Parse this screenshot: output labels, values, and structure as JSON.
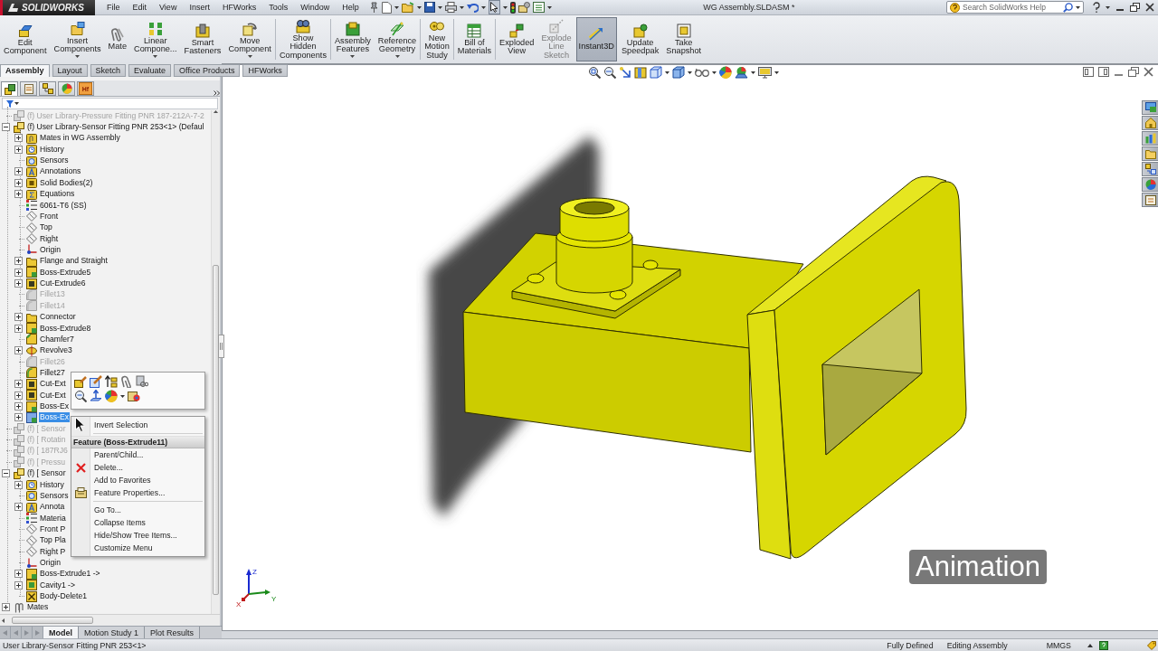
{
  "app": {
    "logo_text": "SOLIDWORKS",
    "menu": [
      "File",
      "Edit",
      "View",
      "Insert",
      "HFWorks",
      "Tools",
      "Window",
      "Help"
    ],
    "document_title": "WG Assembly.SLDASM *",
    "search": {
      "placeholder": "Search SolidWorks Help"
    }
  },
  "ribbon_groups": [
    {
      "buttons": [
        {
          "lines": [
            "Edit",
            "Component"
          ],
          "has_menu": false,
          "disabled": false,
          "selected": false
        },
        {
          "lines": [
            "Insert",
            "Components"
          ],
          "has_menu": true,
          "disabled": false,
          "selected": false
        },
        {
          "lines": [
            "Mate"
          ],
          "has_menu": false,
          "disabled": false,
          "selected": false
        },
        {
          "lines": [
            "Linear",
            "Compone..."
          ],
          "has_menu": true,
          "disabled": false,
          "selected": false
        },
        {
          "lines": [
            "Smart",
            "Fasteners"
          ],
          "has_menu": false,
          "disabled": false,
          "selected": false
        },
        {
          "lines": [
            "Move",
            "Component"
          ],
          "has_menu": true,
          "disabled": false,
          "selected": false
        }
      ]
    },
    {
      "buttons": [
        {
          "lines": [
            "Show",
            "Hidden",
            "Components"
          ],
          "has_menu": false,
          "disabled": false,
          "selected": false
        }
      ]
    },
    {
      "buttons": [
        {
          "lines": [
            "Assembly",
            "Features"
          ],
          "has_menu": true,
          "disabled": false,
          "selected": false
        },
        {
          "lines": [
            "Reference",
            "Geometry"
          ],
          "has_menu": true,
          "disabled": false,
          "selected": false
        }
      ]
    },
    {
      "buttons": [
        {
          "lines": [
            "New",
            "Motion",
            "Study"
          ],
          "has_menu": false,
          "disabled": false,
          "selected": false
        }
      ]
    },
    {
      "buttons": [
        {
          "lines": [
            "Bill of",
            "Materials"
          ],
          "has_menu": false,
          "disabled": false,
          "selected": false
        }
      ]
    },
    {
      "buttons": [
        {
          "lines": [
            "Exploded",
            "View"
          ],
          "has_menu": false,
          "disabled": false,
          "selected": false
        },
        {
          "lines": [
            "Explode",
            "Line",
            "Sketch"
          ],
          "has_menu": false,
          "disabled": true,
          "selected": false
        },
        {
          "lines": [
            "Instant3D"
          ],
          "has_menu": false,
          "disabled": false,
          "selected": true
        },
        {
          "lines": [
            "Update",
            "Speedpak"
          ],
          "has_menu": false,
          "disabled": false,
          "selected": false
        },
        {
          "lines": [
            "Take",
            "Snapshot"
          ],
          "has_menu": false,
          "disabled": false,
          "selected": false
        }
      ]
    }
  ],
  "command_tabs": [
    {
      "label": "Assembly",
      "selected": true
    },
    {
      "label": "Layout",
      "selected": false
    },
    {
      "label": "Sketch",
      "selected": false
    },
    {
      "label": "Evaluate",
      "selected": false
    },
    {
      "label": "Office Products",
      "selected": false
    },
    {
      "label": "HFWorks",
      "selected": false
    }
  ],
  "panel_tabs": [
    {
      "selected": true
    },
    {
      "selected": false
    },
    {
      "selected": false
    },
    {
      "selected": false
    },
    {
      "selected": false,
      "text": "Hf"
    }
  ],
  "feature_tree": {
    "items": [
      {
        "label": "(f) User Library-Pressure Fitting PNR 187-212A-7-2",
        "kind": "component",
        "expandable": false,
        "suppressed": true,
        "selected": false
      },
      {
        "label": "(f) User Library-Sensor Fitting PNR 253<1> (Defaul",
        "kind": "component",
        "expandable": true,
        "expanded": true,
        "suppressed": false,
        "selected": false,
        "children": [
          {
            "label": "Mates in WG Assembly",
            "kind": "mates_folder",
            "expandable": true,
            "expanded": false,
            "suppressed": false,
            "selected": false
          },
          {
            "label": "History",
            "kind": "history",
            "expandable": true,
            "expanded": false,
            "suppressed": false,
            "selected": false
          },
          {
            "label": "Sensors",
            "kind": "sensors",
            "expandable": false,
            "suppressed": false,
            "selected": false
          },
          {
            "label": "Annotations",
            "kind": "annotations",
            "expandable": true,
            "expanded": false,
            "suppressed": false,
            "selected": false
          },
          {
            "label": "Solid Bodies(2)",
            "kind": "bodies",
            "expandable": true,
            "expanded": false,
            "suppressed": false,
            "selected": false
          },
          {
            "label": "Equations",
            "kind": "equations",
            "expandable": true,
            "expanded": false,
            "suppressed": false,
            "selected": false
          },
          {
            "label": "6061-T6 (SS)",
            "kind": "material",
            "expandable": false,
            "suppressed": false,
            "selected": false
          },
          {
            "label": "Front",
            "kind": "plane",
            "expandable": false,
            "suppressed": false,
            "selected": false
          },
          {
            "label": "Top",
            "kind": "plane",
            "expandable": false,
            "suppressed": false,
            "selected": false
          },
          {
            "label": "Right",
            "kind": "plane",
            "expandable": false,
            "suppressed": false,
            "selected": false
          },
          {
            "label": "Origin",
            "kind": "origin",
            "expandable": false,
            "suppressed": false,
            "selected": false
          },
          {
            "label": "Flange and Straight",
            "kind": "folder",
            "expandable": true,
            "expanded": false,
            "suppressed": false,
            "selected": false
          },
          {
            "label": "Boss-Extrude5",
            "kind": "extrude",
            "expandable": true,
            "expanded": false,
            "suppressed": false,
            "selected": false
          },
          {
            "label": "Cut-Extrude6",
            "kind": "cut",
            "expandable": true,
            "expanded": false,
            "suppressed": false,
            "selected": false
          },
          {
            "label": "Fillet13",
            "kind": "fillet",
            "expandable": false,
            "suppressed": true,
            "selected": false
          },
          {
            "label": "Fillet14",
            "kind": "fillet",
            "expandable": false,
            "suppressed": true,
            "selected": false
          },
          {
            "label": "Connector",
            "kind": "folder",
            "expandable": true,
            "expanded": false,
            "suppressed": false,
            "selected": false
          },
          {
            "label": "Boss-Extrude8",
            "kind": "extrude",
            "expandable": true,
            "expanded": false,
            "suppressed": false,
            "selected": false
          },
          {
            "label": "Chamfer7",
            "kind": "chamfer",
            "expandable": false,
            "suppressed": false,
            "selected": false
          },
          {
            "label": "Revolve3",
            "kind": "revolve",
            "expandable": true,
            "expanded": false,
            "suppressed": false,
            "selected": false
          },
          {
            "label": "Fillet26",
            "kind": "fillet",
            "expandable": false,
            "suppressed": true,
            "selected": false
          },
          {
            "label": "Fillet27",
            "kind": "fillet",
            "expandable": false,
            "suppressed": false,
            "selected": false
          },
          {
            "label": "Cut-Ext",
            "kind": "cut",
            "expandable": true,
            "expanded": false,
            "suppressed": false,
            "selected": false
          },
          {
            "label": "Cut-Ext",
            "kind": "cut",
            "expandable": true,
            "expanded": false,
            "suppressed": false,
            "selected": false
          },
          {
            "label": "Boss-Ex",
            "kind": "extrude",
            "expandable": true,
            "expanded": false,
            "suppressed": false,
            "selected": false
          },
          {
            "label": "Boss-Ex",
            "kind": "extrude",
            "expandable": true,
            "expanded": false,
            "suppressed": false,
            "selected": true
          }
        ]
      },
      {
        "label": "(f) [ Sensor",
        "kind": "component",
        "expandable": false,
        "suppressed": true,
        "selected": false
      },
      {
        "label": "(f) [ Rotatin",
        "kind": "component",
        "expandable": false,
        "suppressed": true,
        "selected": false
      },
      {
        "label": "(f) [ 187RJ6",
        "kind": "component",
        "expandable": false,
        "suppressed": true,
        "selected": false
      },
      {
        "label": "(f) [ Pressu",
        "kind": "component",
        "expandable": false,
        "suppressed": true,
        "selected": false
      },
      {
        "label": "(f) [ Sensor",
        "kind": "component",
        "expandable": true,
        "expanded": true,
        "suppressed": false,
        "selected": false,
        "children": [
          {
            "label": "History",
            "kind": "history",
            "expandable": true,
            "expanded": false,
            "suppressed": false,
            "selected": false
          },
          {
            "label": "Sensors",
            "kind": "sensors",
            "expandable": false,
            "suppressed": false,
            "selected": false
          },
          {
            "label": "Annota",
            "kind": "annotations",
            "expandable": true,
            "expanded": false,
            "suppressed": false,
            "selected": false
          },
          {
            "label": "Materia",
            "kind": "material",
            "expandable": false,
            "suppressed": false,
            "selected": false
          },
          {
            "label": "Front P",
            "kind": "plane",
            "expandable": false,
            "suppressed": false,
            "selected": false
          },
          {
            "label": "Top Pla",
            "kind": "plane",
            "expandable": false,
            "suppressed": false,
            "selected": false
          },
          {
            "label": "Right P",
            "kind": "plane",
            "expandable": false,
            "suppressed": false,
            "selected": false
          },
          {
            "label": "Origin",
            "kind": "origin",
            "expandable": false,
            "suppressed": false,
            "selected": false
          },
          {
            "label": "Boss-Extrude1 ->",
            "kind": "extrude",
            "expandable": true,
            "expanded": false,
            "suppressed": false,
            "selected": false
          },
          {
            "label": "Cavity1 ->",
            "kind": "cavity",
            "expandable": true,
            "expanded": false,
            "suppressed": false,
            "selected": false
          },
          {
            "label": "Body-Delete1",
            "kind": "body_delete",
            "expandable": false,
            "suppressed": false,
            "selected": false
          }
        ]
      },
      {
        "label": "Mates",
        "kind": "mates",
        "expandable": true,
        "expanded": false,
        "suppressed": false,
        "selected": false
      }
    ]
  },
  "context_menu": {
    "items": [
      {
        "kind": "item",
        "label": "Invert Selection"
      },
      {
        "kind": "separator"
      },
      {
        "kind": "header",
        "label": "Feature (Boss-Extrude11)"
      },
      {
        "kind": "item",
        "label": "Parent/Child..."
      },
      {
        "kind": "item",
        "label": "Delete..."
      },
      {
        "kind": "item",
        "label": "Add to Favorites"
      },
      {
        "kind": "item",
        "label": "Feature Properties..."
      },
      {
        "kind": "separator"
      },
      {
        "kind": "item",
        "label": "Go To..."
      },
      {
        "kind": "item",
        "label": "Collapse Items"
      },
      {
        "kind": "item",
        "label": "Hide/Show Tree Items..."
      },
      {
        "kind": "item",
        "label": "Customize Menu"
      }
    ]
  },
  "bottom_tabs": [
    {
      "label": "Model",
      "selected": true
    },
    {
      "label": "Motion Study 1",
      "selected": false
    },
    {
      "label": "Plot Results",
      "selected": false
    }
  ],
  "viewport": {
    "axes": [
      "Z",
      "Y",
      "X"
    ],
    "caption": "Animation"
  },
  "status_bar": {
    "selection": "User Library-Sensor Fitting PNR 253<1>",
    "fields": [
      "Fully Defined",
      "Editing Assembly",
      "MMGS"
    ]
  }
}
